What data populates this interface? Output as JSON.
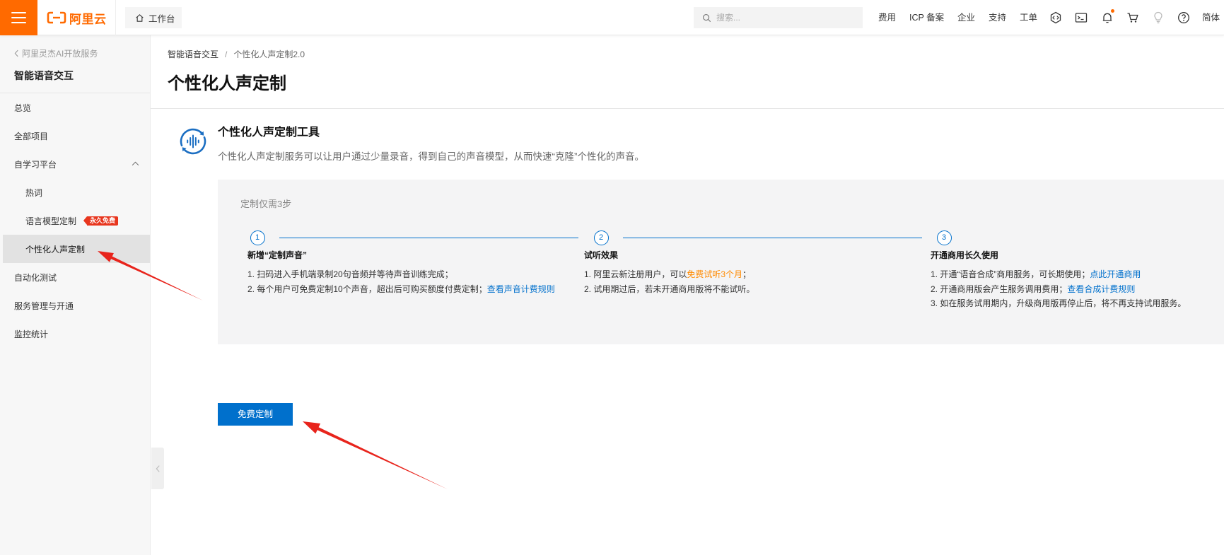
{
  "topbar": {
    "logo_text": "阿里云",
    "workbench_label": "工作台",
    "search_placeholder": "搜索...",
    "nav": [
      "费用",
      "ICP 备案",
      "企业",
      "支持",
      "工单"
    ],
    "icons": [
      "hamburger-menu-icon",
      "home-icon",
      "search-icon",
      "code-icon",
      "terminal-icon",
      "bell-icon",
      "cart-icon",
      "lightbulb-icon",
      "help-icon"
    ],
    "notification_dot": true,
    "language_label": "简体"
  },
  "sidebar": {
    "back_label": "阿里灵杰AI开放服务",
    "title": "智能语音交互",
    "items": [
      {
        "label": "总览",
        "level": 1
      },
      {
        "label": "全部项目",
        "level": 1
      },
      {
        "label": "自学习平台",
        "level": 1,
        "expanded": true
      },
      {
        "label": "热词",
        "level": 2
      },
      {
        "label": "语言模型定制",
        "level": 2,
        "badge": "永久免费"
      },
      {
        "label": "个性化人声定制",
        "level": 2,
        "selected": true
      },
      {
        "label": "自动化测试",
        "level": 1
      },
      {
        "label": "服务管理与开通",
        "level": 1
      },
      {
        "label": "监控统计",
        "level": 1
      }
    ]
  },
  "breadcrumb": {
    "items": [
      "智能语音交互",
      "个性化人声定制2.0"
    ],
    "separator": "/"
  },
  "page_title": "个性化人声定制",
  "tool": {
    "icon": "voice-customization-icon",
    "title": "个性化人声定制工具",
    "description": "个性化人声定制服务可以让用户通过少量录音，得到自己的声音模型，从而快速“克隆”个性化的声音。"
  },
  "steps_panel": {
    "label": "定制仅需3步",
    "steps": [
      {
        "number": "1",
        "title": "新增“定制声音”",
        "lines": [
          {
            "text": "1. 扫码进入手机端录制20句音频并等待声音训练完成；"
          },
          {
            "text": "2. 每个用户可免费定制10个声音，超出后可购买额度付费定制；",
            "link": "查看声音计费规则"
          }
        ]
      },
      {
        "number": "2",
        "title": "试听效果",
        "lines": [
          {
            "text": "1. 阿里云新注册用户，可以",
            "highlight": "免费试听3个月",
            "suffix": "；"
          },
          {
            "text": "2. 试用期过后，若未开通商用版将不能试听。"
          }
        ]
      },
      {
        "number": "3",
        "title": "开通商用长久使用",
        "lines": [
          {
            "text": "1. 开通“语音合成”商用服务，可长期使用；",
            "link": "点此开通商用"
          },
          {
            "text": "2. 开通商用版会产生服务调用费用；",
            "link": "查看合成计费规则"
          },
          {
            "text": "3. 如在服务试用期内，升级商用版再停止后，将不再支持试用服务。"
          }
        ]
      }
    ]
  },
  "primary_button": {
    "label": "免费定制"
  },
  "colors": {
    "brand": "#ff6a00",
    "primary": "#0070cc",
    "link": "#0070cc",
    "highlight": "#ff8a00",
    "badge": "#e8361e",
    "selected_item_bg": "#e2e2e2",
    "annotation_arrow": "#e8241c"
  }
}
